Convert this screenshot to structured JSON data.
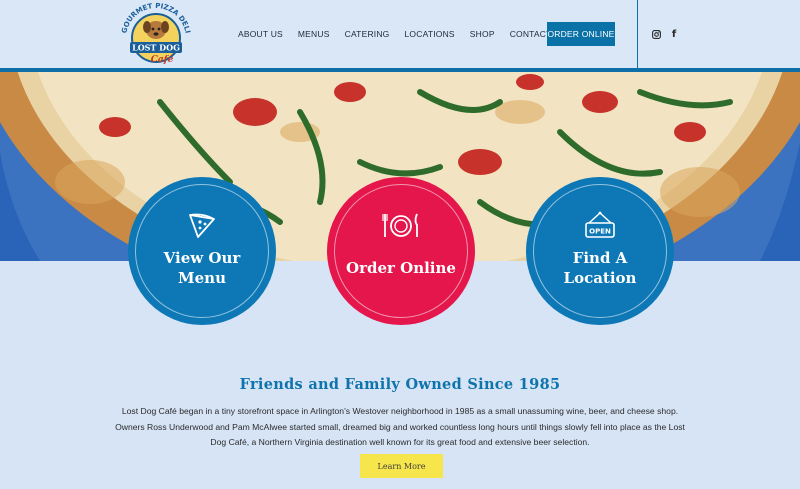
{
  "logo": {
    "arc_text": "GOURMET PIZZA DELI",
    "name_line1": "LOST DOG",
    "name_line2": "Café"
  },
  "nav": {
    "items": [
      "ABOUT US",
      "MENUS",
      "CATERING",
      "LOCATIONS",
      "SHOP",
      "CONTACT US"
    ],
    "order_label": "ORDER ONLINE"
  },
  "social": {
    "icons": [
      "instagram-icon",
      "facebook-icon"
    ],
    "facebook_glyph": "f"
  },
  "circles": [
    {
      "label": "View Our Menu",
      "icon": "pizza-slice-icon",
      "color": "#0e78b6"
    },
    {
      "label": "Order Online",
      "icon": "plate-utensils-icon",
      "color": "#e4164c"
    },
    {
      "label": "Find A Location",
      "icon": "open-sign-icon",
      "sign_text": "OPEN",
      "color": "#0e78b6"
    }
  ],
  "about": {
    "title": "Friends and Family Owned Since 1985",
    "body": "Lost Dog Café began in a tiny storefront space in Arlington’s Westover neighborhood in 1985 as a small unassuming wine, beer, and cheese shop. Owners Ross Underwood and Pam McAlwee started small, dreamed big and worked countless long hours until things slowly fell into place as the Lost Dog Café, a Northern Virginia destination well known for its great food and extensive beer selection.",
    "button_label": "Learn More"
  },
  "colors": {
    "primary": "#0e78b6",
    "accent_red": "#e4164c",
    "button_yellow": "#f7e64b",
    "background": "#d6e4f6"
  }
}
